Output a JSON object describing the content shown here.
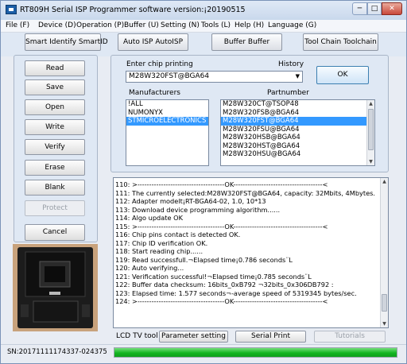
{
  "window": {
    "title": "RT809H Serial ISP Programmer software version:¡20190515",
    "minimize_glyph": "─",
    "maximize_glyph": "□",
    "close_glyph": "✕"
  },
  "menu": [
    "File (F)",
    "Device (D)",
    "Operation (P)",
    "Buffer (U)",
    "Setting (N)",
    "Tools (L)",
    "Help (H)",
    "Language (G)"
  ],
  "toolbar": {
    "smart_identify": "Smart Identify SmartID",
    "auto_isp": "Auto ISP AutoISP",
    "buffer": "Buffer Buffer",
    "tool_chain": "Tool Chain Toolchain"
  },
  "sidebar": {
    "read": "Read",
    "save": "Save",
    "open": "Open",
    "write": "Write",
    "verify": "Verify",
    "erase": "Erase",
    "blank": "Blank",
    "protect": "Protect",
    "cancel": "Cancel"
  },
  "chip": {
    "enter_label": "Enter chip printing",
    "history_label": "History",
    "value": "M28W320FST@BGA64",
    "ok_label": "OK"
  },
  "manufacturers": {
    "label": "Manufacturers",
    "items": [
      "!ALL",
      "NUMONYX",
      "STMICROELECTRONICS"
    ],
    "selected_index": 2
  },
  "partnumbers": {
    "label": "Partnumber",
    "items": [
      "M28W320CT@TSOP48",
      "M28W320FSB@BGA64",
      "M28W320FST@BGA64",
      "M28W320FSU@BGA64",
      "M28W320HSB@BGA64",
      "M28W320HST@BGA64",
      "M28W320HSU@BGA64"
    ],
    "selected_index": 2
  },
  "log": [
    "110:  >-------------------------------------OK--------------------------------------<",
    "111:  The currently selected:M28W320FST@BGA64, capacity: 32Mbits, 4Mbytes.",
    "112:  Adapter modelt¡RT-BGA64-02, 1.0, 10*13",
    "113:  Download device programming algorithm......",
    "114:  Algo update OK",
    "115:  >-------------------------------------OK--------------------------------------<",
    "116:  Chip pins contact is detected OK.",
    "117:  Chip ID verification OK.",
    "118:  Start reading chip......",
    "119:  Read successfull.¬Elapsed time¡0.786 seconds¨L",
    "120:  Auto verifying...",
    "121:  Verification successful!¬Elapsed time¡0.785 seconds¨L",
    "122:  Buffer data checksum: 16bits_0xB792 ¬32bits_0x306DB792 :",
    "123:  Elapsed time: 1.577 seconds¬-average speed of 5319345 bytes/sec.",
    "124:  >-------------------------------------OK--------------------------------------<"
  ],
  "bottom": {
    "lcd_label": "LCD TV tool",
    "parameter_setting": "Parameter setting",
    "serial_print": "Serial Print",
    "tutorials": "Tutorials"
  },
  "status": {
    "serial_number": "SN:20171111174337-024375",
    "progress_fraction": 1.0
  },
  "colors": {
    "selection": "#3399ff",
    "progress": "#14b522",
    "panel": "#dfe8f4"
  },
  "icons": {
    "app": "chip-programmer-icon",
    "dropdown": "chevron-down-icon"
  }
}
